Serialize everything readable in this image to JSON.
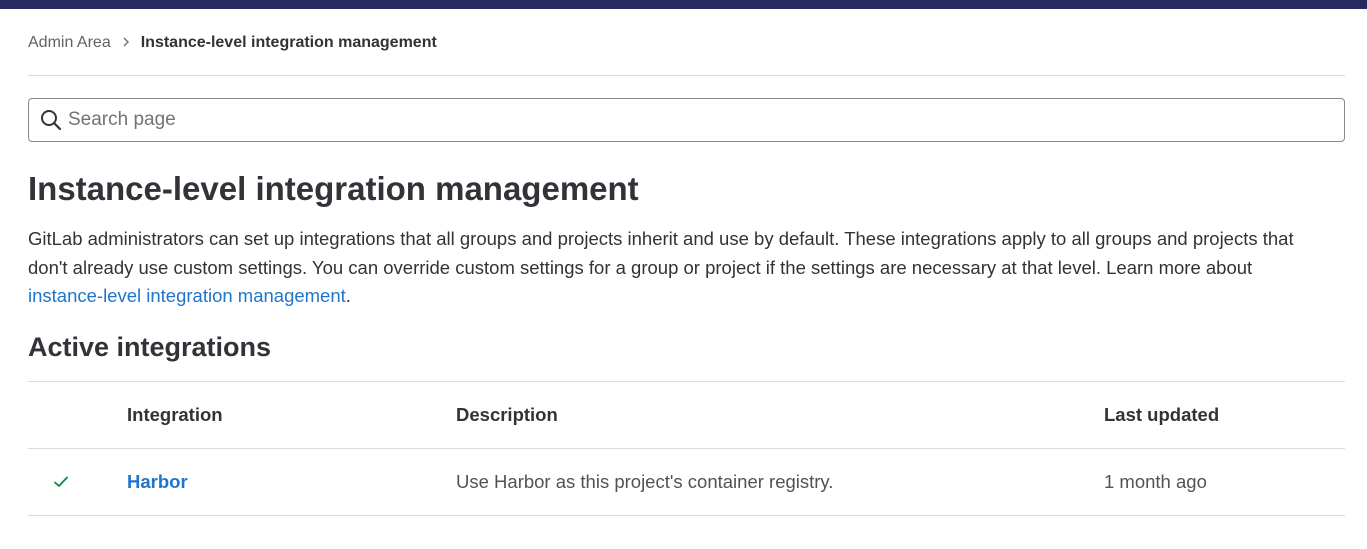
{
  "breadcrumb": {
    "parent": "Admin Area",
    "current": "Instance-level integration management"
  },
  "search": {
    "placeholder": "Search page",
    "value": ""
  },
  "page": {
    "title": "Instance-level integration management",
    "description_text": "GitLab administrators can set up integrations that all groups and projects inherit and use by default. These integrations apply to all groups and projects that don't already use custom settings. You can override custom settings for a group or project if the settings are necessary at that level. Learn more about ",
    "description_link": "instance-level integration management",
    "description_end": "."
  },
  "active_integrations": {
    "title": "Active integrations",
    "columns": {
      "integration": "Integration",
      "description": "Description",
      "last_updated": "Last updated"
    },
    "rows": [
      {
        "status_icon": "check-icon",
        "name": "Harbor",
        "description": "Use Harbor as this project's container registry.",
        "last_updated": "1 month ago"
      }
    ]
  },
  "colors": {
    "topbar": "#292961",
    "link": "#1f75cb",
    "success": "#108548",
    "text": "#333238"
  }
}
